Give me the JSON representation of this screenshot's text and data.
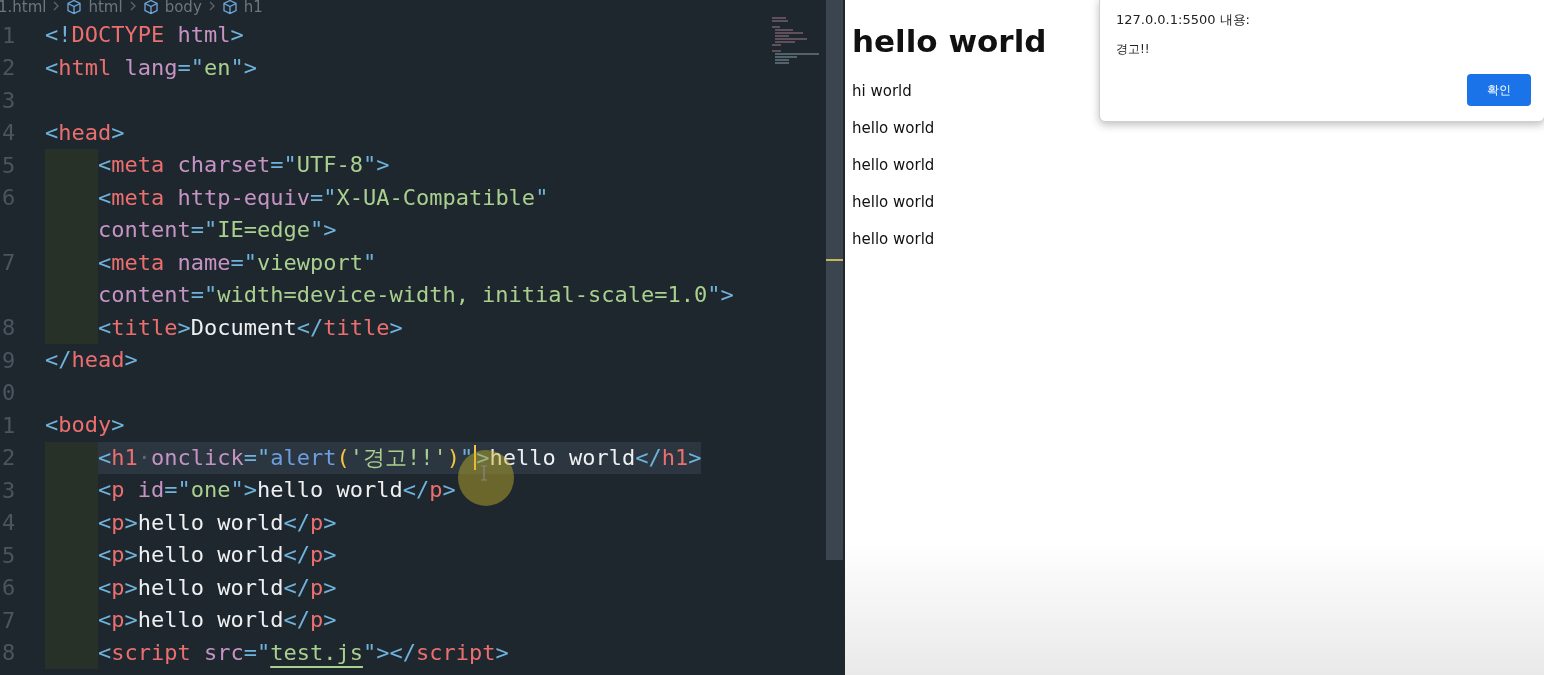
{
  "editor": {
    "breadcrumb": [
      "1.html",
      "html",
      "body",
      "h1"
    ],
    "lines": [
      {
        "number": "1",
        "indented": false,
        "current": false,
        "tokens": [
          {
            "text": "<!",
            "kind": "punct"
          },
          {
            "text": "DOCTYPE",
            "kind": "tag"
          },
          {
            "text": " html",
            "kind": "attr"
          },
          {
            "text": ">",
            "kind": "punct"
          }
        ]
      },
      {
        "number": "2",
        "indented": false,
        "current": false,
        "tokens": [
          {
            "text": "<",
            "kind": "punct"
          },
          {
            "text": "html",
            "kind": "tag"
          },
          {
            "text": " lang",
            "kind": "attr"
          },
          {
            "text": "=\"",
            "kind": "punct"
          },
          {
            "text": "en",
            "kind": "string"
          },
          {
            "text": "\">",
            "kind": "punct"
          }
        ]
      },
      {
        "number": "3"
      },
      {
        "number": "4",
        "indented": false,
        "current": false,
        "tokens": [
          {
            "text": "<",
            "kind": "punct"
          },
          {
            "text": "head",
            "kind": "tag"
          },
          {
            "text": ">",
            "kind": "punct"
          }
        ]
      },
      {
        "number": "5",
        "indented": true,
        "current": false,
        "tokens": [
          {
            "text": "<",
            "kind": "punct"
          },
          {
            "text": "meta",
            "kind": "tag"
          },
          {
            "text": " charset",
            "kind": "attr"
          },
          {
            "text": "=\"",
            "kind": "punct"
          },
          {
            "text": "UTF-8",
            "kind": "string"
          },
          {
            "text": "\">",
            "kind": "punct"
          }
        ]
      },
      {
        "number": "6",
        "indented": true,
        "current": false,
        "tokens": [
          {
            "text": "<",
            "kind": "punct"
          },
          {
            "text": "meta",
            "kind": "tag"
          },
          {
            "text": " http-equiv",
            "kind": "attr"
          },
          {
            "text": "=\"",
            "kind": "punct"
          },
          {
            "text": "X-UA-Compatible",
            "kind": "string"
          },
          {
            "text": "\"",
            "kind": "punct"
          }
        ]
      },
      {
        "indented": true,
        "current": false,
        "tokens": [
          {
            "text": "content",
            "kind": "attr"
          },
          {
            "text": "=\"",
            "kind": "punct"
          },
          {
            "text": "IE=edge",
            "kind": "string"
          },
          {
            "text": "\">",
            "kind": "punct"
          }
        ]
      },
      {
        "number": "7",
        "indented": true,
        "current": false,
        "tokens": [
          {
            "text": "<",
            "kind": "punct"
          },
          {
            "text": "meta",
            "kind": "tag"
          },
          {
            "text": " name",
            "kind": "attr"
          },
          {
            "text": "=\"",
            "kind": "punct"
          },
          {
            "text": "viewport",
            "kind": "string"
          },
          {
            "text": "\"",
            "kind": "punct"
          }
        ]
      },
      {
        "indented": true,
        "current": false,
        "tokens": [
          {
            "text": "content",
            "kind": "attr"
          },
          {
            "text": "=\"",
            "kind": "punct"
          },
          {
            "text": "width=device-width, initial-scale=1.0",
            "kind": "string"
          },
          {
            "text": "\">",
            "kind": "punct"
          }
        ]
      },
      {
        "number": "8",
        "indented": true,
        "current": false,
        "tokens": [
          {
            "text": "<",
            "kind": "punct"
          },
          {
            "text": "title",
            "kind": "tag"
          },
          {
            "text": ">",
            "kind": "punct"
          },
          {
            "text": "Document",
            "kind": "text"
          },
          {
            "text": "</",
            "kind": "punct"
          },
          {
            "text": "title",
            "kind": "tag"
          },
          {
            "text": ">",
            "kind": "punct"
          }
        ]
      },
      {
        "number": "9",
        "indented": false,
        "current": false,
        "tokens": [
          {
            "text": "</",
            "kind": "punct"
          },
          {
            "text": "head",
            "kind": "tag"
          },
          {
            "text": ">",
            "kind": "punct"
          }
        ]
      },
      {
        "number": "0"
      },
      {
        "number": "1",
        "indented": false,
        "current": false,
        "tokens": [
          {
            "text": "<",
            "kind": "punct"
          },
          {
            "text": "body",
            "kind": "tag"
          },
          {
            "text": ">",
            "kind": "punct"
          }
        ]
      },
      {
        "number": "2",
        "indented": true,
        "current": true,
        "tokens": [
          {
            "text": "<",
            "kind": "punct"
          },
          {
            "text": "h1",
            "kind": "tag"
          },
          {
            "text": "·",
            "kind": "ws"
          },
          {
            "text": "onclick",
            "kind": "attr"
          },
          {
            "text": "=\"",
            "kind": "punct"
          },
          {
            "text": "alert",
            "kind": "func"
          },
          {
            "text": "(",
            "kind": "paren"
          },
          {
            "text": "'경고!!'",
            "kind": "string"
          },
          {
            "text": ")",
            "kind": "paren"
          },
          {
            "text": "\"",
            "kind": "punct"
          },
          {
            "text": ">",
            "kind": "punct",
            "caret": true
          },
          {
            "text": "hello world",
            "kind": "text"
          },
          {
            "text": "</",
            "kind": "punct"
          },
          {
            "text": "h1",
            "kind": "tag"
          },
          {
            "text": ">",
            "kind": "punct"
          }
        ]
      },
      {
        "number": "3",
        "indented": true,
        "current": false,
        "tokens": [
          {
            "text": "<",
            "kind": "punct"
          },
          {
            "text": "p",
            "kind": "tag"
          },
          {
            "text": " id",
            "kind": "attr"
          },
          {
            "text": "=\"",
            "kind": "punct"
          },
          {
            "text": "one",
            "kind": "string"
          },
          {
            "text": "\">",
            "kind": "punct"
          },
          {
            "text": "hello world",
            "kind": "text"
          },
          {
            "text": "</",
            "kind": "punct"
          },
          {
            "text": "p",
            "kind": "tag"
          },
          {
            "text": ">",
            "kind": "punct"
          }
        ]
      },
      {
        "number": "4",
        "indented": true,
        "current": false,
        "tokens": [
          {
            "text": "<",
            "kind": "punct"
          },
          {
            "text": "p",
            "kind": "tag"
          },
          {
            "text": ">",
            "kind": "punct"
          },
          {
            "text": "hello world",
            "kind": "text"
          },
          {
            "text": "</",
            "kind": "punct"
          },
          {
            "text": "p",
            "kind": "tag"
          },
          {
            "text": ">",
            "kind": "punct"
          }
        ]
      },
      {
        "number": "5",
        "indented": true,
        "current": false,
        "tokens": [
          {
            "text": "<",
            "kind": "punct"
          },
          {
            "text": "p",
            "kind": "tag"
          },
          {
            "text": ">",
            "kind": "punct"
          },
          {
            "text": "hello world",
            "kind": "text"
          },
          {
            "text": "</",
            "kind": "punct"
          },
          {
            "text": "p",
            "kind": "tag"
          },
          {
            "text": ">",
            "kind": "punct"
          }
        ]
      },
      {
        "number": "6",
        "indented": true,
        "current": false,
        "tokens": [
          {
            "text": "<",
            "kind": "punct"
          },
          {
            "text": "p",
            "kind": "tag"
          },
          {
            "text": ">",
            "kind": "punct"
          },
          {
            "text": "hello world",
            "kind": "text"
          },
          {
            "text": "</",
            "kind": "punct"
          },
          {
            "text": "p",
            "kind": "tag"
          },
          {
            "text": ">",
            "kind": "punct"
          }
        ]
      },
      {
        "number": "7",
        "indented": true,
        "current": false,
        "tokens": [
          {
            "text": "<",
            "kind": "punct"
          },
          {
            "text": "p",
            "kind": "tag"
          },
          {
            "text": ">",
            "kind": "punct"
          },
          {
            "text": "hello world",
            "kind": "text"
          },
          {
            "text": "</",
            "kind": "punct"
          },
          {
            "text": "p",
            "kind": "tag"
          },
          {
            "text": ">",
            "kind": "punct"
          }
        ]
      },
      {
        "number": "8",
        "indented": true,
        "current": false,
        "tokens": [
          {
            "text": "<",
            "kind": "punct"
          },
          {
            "text": "script",
            "kind": "tag"
          },
          {
            "text": " src",
            "kind": "attr"
          },
          {
            "text": "=\"",
            "kind": "punct"
          },
          {
            "text": "test.js",
            "kind": "link"
          },
          {
            "text": "\">",
            "kind": "punct"
          },
          {
            "text": "</",
            "kind": "punct"
          },
          {
            "text": "script",
            "kind": "tag"
          },
          {
            "text": ">",
            "kind": "punct"
          }
        ]
      }
    ]
  },
  "page": {
    "heading": "hello world",
    "paragraphs": [
      "hi world",
      "hello world",
      "hello world",
      "hello world",
      "hello world"
    ]
  },
  "alert": {
    "title": "127.0.0.1:5500 내용:",
    "message": "경고!!",
    "button": "확인"
  }
}
